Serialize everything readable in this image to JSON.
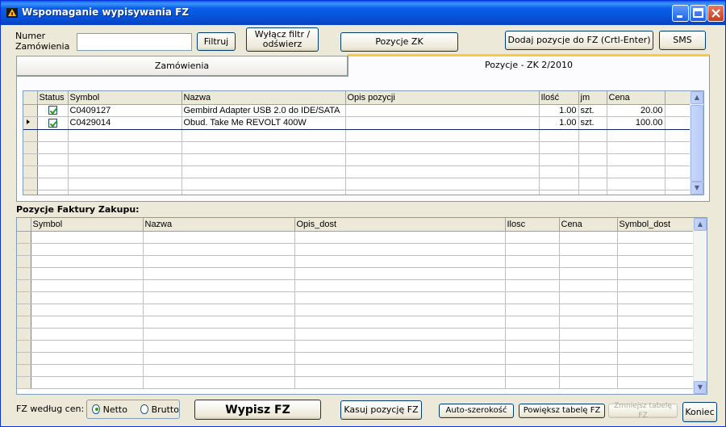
{
  "window": {
    "title": "Wspomaganie wypisywania FZ",
    "minimize": "_",
    "maximize": "□",
    "close": "✕"
  },
  "toolbar": {
    "order_number_label_1": "Numer",
    "order_number_label_2": "Zamówienia",
    "order_number_value": "",
    "filter_button": "Filtruj",
    "clear_filter_line1": "Wyłącz filtr /",
    "clear_filter_line2": "odświerz",
    "positions_zk_button": "Pozycje ZK",
    "add_positions_button": "Dodaj pozycje do FZ (Crtl-Enter)",
    "sms_button": "SMS"
  },
  "tabs": [
    {
      "label": "Zamówienia",
      "active": false
    },
    {
      "label": "Pozycje - ZK 2/2010",
      "active": true
    }
  ],
  "zk_grid": {
    "columns": [
      "Status",
      "Symbol",
      "Nazwa",
      "Opis pozycji",
      "Ilość",
      "jm",
      "Cena"
    ],
    "rows": [
      {
        "status": true,
        "symbol": "C0409127",
        "nazwa": "Gembird  Adapter USB 2.0 do IDE/SATA",
        "opis": "",
        "ilosc": "1.00",
        "jm": "szt.",
        "cena": "20.00",
        "selected": false
      },
      {
        "status": true,
        "symbol": "C0429014",
        "nazwa": "Obud. Take Me REVOLT 400W",
        "opis": "",
        "ilosc": "1.00",
        "jm": "szt.",
        "cena": "100.00",
        "selected": true
      }
    ]
  },
  "fz_section_title": "Pozycje Faktury Zakupu:",
  "fz_grid": {
    "columns": [
      "Symbol",
      "Nazwa",
      "Opis_dost",
      "Ilosc",
      "Cena",
      "Symbol_dost"
    ]
  },
  "bottom": {
    "price_label": "FZ według cen:",
    "netto": "Netto",
    "brutto": "Brutto",
    "selected_price": "Netto",
    "write_fz_button": "Wypisz FZ",
    "delete_position_button": "Kasuj pozycję FZ",
    "autowidth_button": "Auto-szerokość",
    "enlarge_table_button": "Powiększ tabelę FZ",
    "shrink_table_button": "Zmniejsz tabelę FZ",
    "end_button": "Koniec"
  },
  "colors": {
    "titlebar": "#0a5fe8",
    "window_bg": "#ece9d8",
    "active_tab_accent": "#ffc83c",
    "check_green": "#21a121"
  }
}
